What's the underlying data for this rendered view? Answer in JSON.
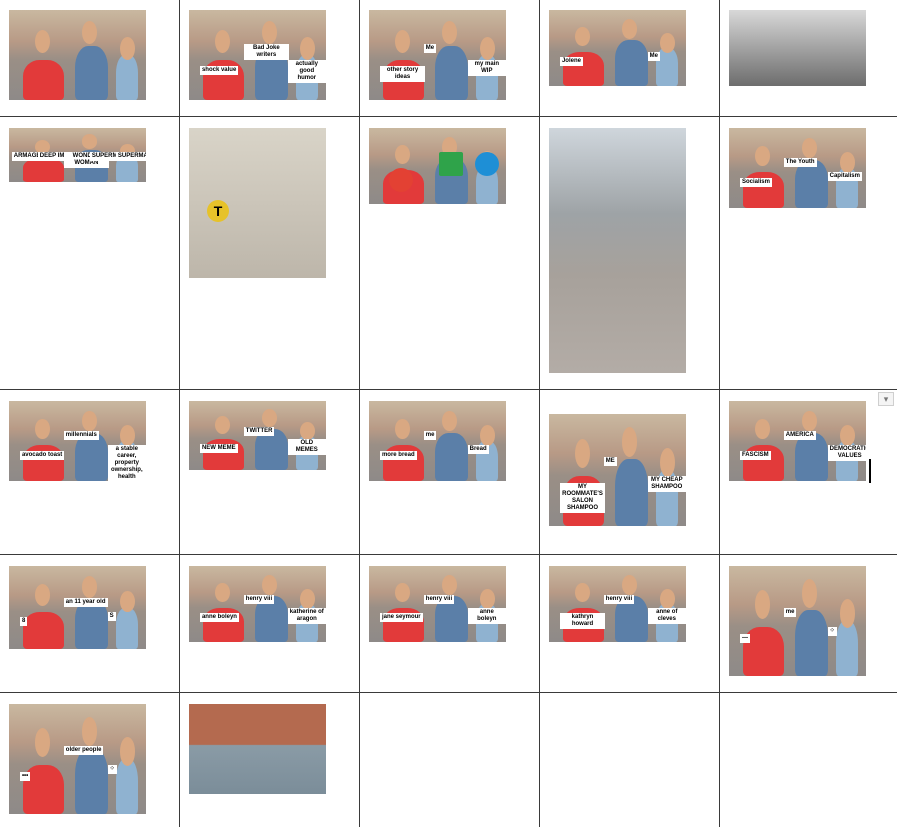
{
  "grid": {
    "columns": 5,
    "rows": 6
  },
  "cells": [
    {
      "id": "r1c1",
      "type": "meme",
      "captions": []
    },
    {
      "id": "r1c2",
      "type": "meme",
      "captions": [
        "shock value",
        "Bad Joke writers",
        "actually good humor"
      ]
    },
    {
      "id": "r1c3",
      "type": "meme",
      "captions": [
        "other story ideas",
        "Me",
        "my main WIP"
      ]
    },
    {
      "id": "r1c4",
      "type": "meme",
      "captions": [
        "Jolene",
        "Me"
      ]
    },
    {
      "id": "r1c5",
      "type": "photo",
      "style": "black-and-white",
      "captions": []
    },
    {
      "id": "r2c1",
      "type": "meme",
      "captions": [
        "ARMAGEDDON",
        "DEEP IMPACT",
        "WONDER WOMAN",
        "SUPERMAN",
        "SUPERMAN"
      ]
    },
    {
      "id": "r2c2",
      "type": "photo",
      "style": "cosplay",
      "badge_letter": "T",
      "captions": []
    },
    {
      "id": "r2c3",
      "type": "meme",
      "captions": [],
      "icons": [
        "chrome-logo-icon",
        "windows-logo-icon",
        "internet-explorer-logo-icon"
      ]
    },
    {
      "id": "r2c4",
      "type": "photo",
      "style": "street",
      "captions": []
    },
    {
      "id": "r2c5",
      "type": "meme",
      "captions": [
        "Socialism",
        "The Youth",
        "Capitalism"
      ]
    },
    {
      "id": "r3c1",
      "type": "meme",
      "captions": [
        "avocado toast",
        "millennials",
        "a stable career, property ownership, health insurance"
      ]
    },
    {
      "id": "r3c2",
      "type": "meme",
      "captions": [
        "NEW MEME",
        "TWITTER",
        "OLD MEMES"
      ]
    },
    {
      "id": "r3c3",
      "type": "meme",
      "captions": [
        "more bread",
        "me",
        "Bread"
      ]
    },
    {
      "id": "r3c4",
      "type": "meme",
      "captions": [
        "MY ROOMMATE'S SALON SHAMPOO",
        "ME",
        "MY CHEAP SHAMPOO"
      ]
    },
    {
      "id": "r3c5",
      "type": "meme",
      "captions": [
        "FASCISM",
        "AMERICA",
        "DEMOCRATIC VALUES"
      ]
    },
    {
      "id": "r4c1",
      "type": "meme",
      "captions": [
        "8",
        "an 11 year old",
        "S"
      ]
    },
    {
      "id": "r4c2",
      "type": "meme",
      "captions": [
        "anne boleyn",
        "henry viii",
        "katherine of aragon"
      ]
    },
    {
      "id": "r4c3",
      "type": "meme",
      "captions": [
        "jane seymour",
        "henry viii",
        "anne boleyn"
      ]
    },
    {
      "id": "r4c4",
      "type": "meme",
      "captions": [
        "kathryn howard",
        "henry viii",
        "anne of cleves"
      ]
    },
    {
      "id": "r4c5",
      "type": "meme",
      "captions": [
        "—",
        "me",
        "⁘"
      ]
    },
    {
      "id": "r5c1",
      "type": "meme",
      "captions": [
        "•••",
        "older people",
        "⁘"
      ]
    },
    {
      "id": "r5c2",
      "type": "photo",
      "style": "lego",
      "captions": []
    }
  ],
  "ui": {
    "dropdown_glyph": "▾"
  },
  "colors": {
    "grid_line": "#3a3a3a",
    "girlfriend_dress": "#e23a3a",
    "boyfriend_shirt": "#5b7fa8"
  }
}
